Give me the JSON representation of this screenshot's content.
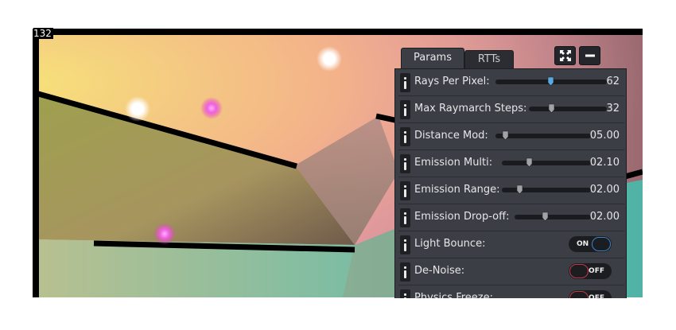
{
  "fps_counter": "132",
  "tabs": [
    {
      "label": "Params",
      "active": true
    },
    {
      "label": "RTTs",
      "active": false
    }
  ],
  "window_buttons": {
    "maximize_icon": "expand-arrows-icon",
    "minimize_icon": "minus-icon"
  },
  "params": [
    {
      "label": "Rays Per Pixel:",
      "value": "62",
      "slider_fraction": 0.49,
      "thumb_color": "#5aa8e0"
    },
    {
      "label": "Max Raymarch Steps:",
      "value": "32",
      "slider_fraction": 0.29,
      "thumb_color": "#a0a2a6"
    },
    {
      "label": "Distance Mod:",
      "value": "05.00",
      "slider_fraction": 0.1,
      "thumb_color": "#a0a2a6"
    },
    {
      "label": "Emission Multi:",
      "value": "02.10",
      "slider_fraction": 0.3,
      "thumb_color": "#a0a2a6"
    },
    {
      "label": "Emission Range:",
      "value": "02.00",
      "slider_fraction": 0.2,
      "thumb_color": "#a0a2a6"
    },
    {
      "label": "Emission Drop-off:",
      "value": "02.00",
      "slider_fraction": 0.4,
      "thumb_color": "#a0a2a6"
    }
  ],
  "toggles": [
    {
      "label": "Light Bounce:",
      "state": "ON"
    },
    {
      "label": "De-Noise:",
      "state": "OFF"
    },
    {
      "label": "Physics Freeze:",
      "state": "OFF"
    }
  ]
}
